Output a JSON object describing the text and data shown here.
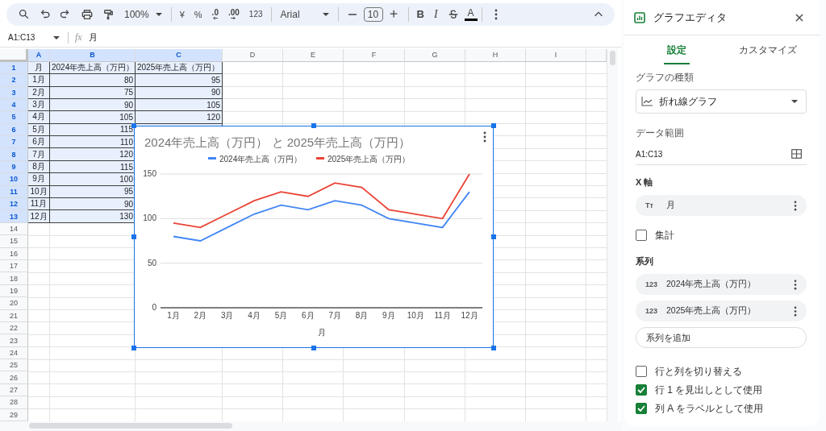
{
  "toolbar": {
    "groups": [
      [
        {
          "kind": "search"
        },
        {
          "kind": "undo"
        },
        {
          "kind": "redo"
        },
        {
          "kind": "print"
        },
        {
          "kind": "paint"
        },
        {
          "kind": "zoom",
          "text": "100%"
        }
      ],
      [
        {
          "kind": "currency",
          "text": "¥"
        },
        {
          "kind": "percent",
          "text": "%"
        },
        {
          "kind": "decrease",
          "text": ".0"
        },
        {
          "kind": "increase",
          "text": ".00"
        },
        {
          "kind": "format",
          "text": "123"
        }
      ],
      [
        {
          "kind": "font",
          "text": "Arial"
        }
      ],
      [
        {
          "kind": "minus"
        },
        {
          "kind": "size",
          "text": "10"
        },
        {
          "kind": "plus"
        }
      ],
      [
        {
          "kind": "bold",
          "text": "B"
        },
        {
          "kind": "italic",
          "text": "I"
        },
        {
          "kind": "strike"
        },
        {
          "kind": "color",
          "text": "A"
        }
      ],
      [
        {
          "kind": "more"
        }
      ]
    ]
  },
  "formula_bar": {
    "name_box": "A1:C13",
    "fx_label": "fx",
    "formula": "月"
  },
  "sheet": {
    "columns": [
      {
        "label": "A",
        "selected": true
      },
      {
        "label": "B",
        "selected": true
      },
      {
        "label": "C",
        "selected": true
      },
      {
        "label": "D",
        "selected": false
      },
      {
        "label": "E",
        "selected": false
      },
      {
        "label": "F",
        "selected": false
      },
      {
        "label": "G",
        "selected": false
      },
      {
        "label": "H",
        "selected": false
      },
      {
        "label": "I",
        "selected": false
      }
    ],
    "rows": [
      {
        "label": "1",
        "selected": true,
        "cells": [
          "月",
          "2024年売上高（万円）",
          "2025年売上高（万円）"
        ]
      },
      {
        "label": "2",
        "selected": true,
        "cells": [
          "1月",
          "80",
          "95"
        ]
      },
      {
        "label": "3",
        "selected": true,
        "cells": [
          "2月",
          "75",
          "90"
        ]
      },
      {
        "label": "4",
        "selected": true,
        "cells": [
          "3月",
          "90",
          "105"
        ]
      },
      {
        "label": "5",
        "selected": true,
        "cells": [
          "4月",
          "105",
          "120"
        ]
      },
      {
        "label": "6",
        "selected": true,
        "cells": [
          "5月",
          "115"
        ]
      },
      {
        "label": "7",
        "selected": true,
        "cells": [
          "6月",
          "110"
        ]
      },
      {
        "label": "8",
        "selected": true,
        "cells": [
          "7月",
          "120"
        ]
      },
      {
        "label": "9",
        "selected": true,
        "cells": [
          "8月",
          "115"
        ]
      },
      {
        "label": "10",
        "selected": true,
        "cells": [
          "9月",
          "100"
        ]
      },
      {
        "label": "11",
        "selected": true,
        "cells": [
          "10月",
          "95"
        ]
      },
      {
        "label": "12",
        "selected": true,
        "cells": [
          "11月",
          "90"
        ]
      },
      {
        "label": "13",
        "selected": true,
        "cells": [
          "12月",
          "130"
        ]
      },
      {
        "label": "14",
        "selected": false
      },
      {
        "label": "15",
        "selected": false
      },
      {
        "label": "16",
        "selected": false
      },
      {
        "label": "17",
        "selected": false
      },
      {
        "label": "18",
        "selected": false
      },
      {
        "label": "19",
        "selected": false
      },
      {
        "label": "20",
        "selected": false
      },
      {
        "label": "21",
        "selected": false
      },
      {
        "label": "22",
        "selected": false
      },
      {
        "label": "23",
        "selected": false
      },
      {
        "label": "24",
        "selected": false
      },
      {
        "label": "25",
        "selected": false
      },
      {
        "label": "26",
        "selected": false
      },
      {
        "label": "27",
        "selected": false
      },
      {
        "label": "28",
        "selected": false
      },
      {
        "label": "29",
        "selected": false
      }
    ],
    "chart": {
      "chart_data": {
        "type": "line",
        "title": "2024年売上高（万円） と 2025年売上高（万円）",
        "xlabel": "月",
        "categories": [
          "1月",
          "2月",
          "3月",
          "4月",
          "5月",
          "6月",
          "7月",
          "8月",
          "9月",
          "10月",
          "11月",
          "12月"
        ],
        "series": [
          {
            "name": "2024年売上高（万円）",
            "color": "#4285f4",
            "values": [
              80,
              75,
              90,
              105,
              115,
              110,
              120,
              115,
              100,
              95,
              90,
              130
            ]
          },
          {
            "name": "2025年売上高（万円）",
            "color": "#ea4335",
            "values": [
              95,
              90,
              105,
              120,
              130,
              125,
              140,
              135,
              110,
              105,
              100,
              150
            ]
          }
        ],
        "ylim": [
          0,
          150
        ],
        "yticks": [
          {
            "value": 0,
            "label": "0"
          },
          {
            "value": 50,
            "label": "50"
          },
          {
            "value": 100,
            "label": "100"
          },
          {
            "value": 150,
            "label": "150"
          }
        ],
        "legend": "top"
      }
    }
  },
  "editor": {
    "title": "グラフエディタ",
    "tabs": [
      {
        "label": "設定",
        "selected": true
      },
      {
        "label": "カスタマイズ",
        "selected": false
      }
    ],
    "chart_type": {
      "label": "グラフの種類",
      "value": "折れ線グラフ"
    },
    "data_range": {
      "label": "データ範囲",
      "value": "A1:C13"
    },
    "x_axis": {
      "label": "X 軸",
      "items": [
        {
          "type_label": "Tт",
          "name": "月"
        }
      ]
    },
    "aggregate": {
      "label": "集計",
      "checked": false
    },
    "series": {
      "label": "系列",
      "items": [
        {
          "type_label": "123",
          "name": "2024年売上高（万円）"
        },
        {
          "type_label": "123",
          "name": "2025年売上高（万円）"
        }
      ],
      "add_button": "系列を追加"
    },
    "options": [
      {
        "label": "行と列を切り替える",
        "checked": false
      },
      {
        "label": "行 1 を見出しとして使用",
        "checked": true
      },
      {
        "label": "列 A をラベルとして使用",
        "checked": true
      }
    ]
  }
}
